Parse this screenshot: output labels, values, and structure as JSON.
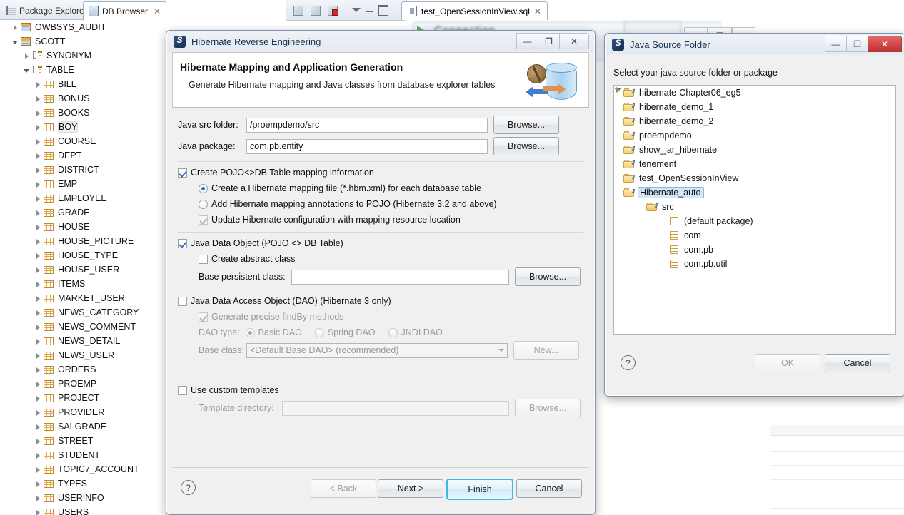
{
  "workbench": {
    "tabs": [
      {
        "label": "Package Explorer",
        "icon": "package-explorer-icon",
        "active": false,
        "closable": false
      },
      {
        "label": "DB Browser",
        "icon": "db-browser-icon",
        "active": true,
        "closable": true
      }
    ],
    "editor_tab": {
      "label": "test_OpenSessionInView.sql",
      "icon": "sql-file-icon",
      "closable": true
    },
    "toolbar_icons": [
      "import-icon",
      "export-icon",
      "refresh-connection-icon",
      "view-menu-icon",
      "minimize-icon",
      "maximize-icon"
    ],
    "ghost_window": {
      "buttons": [
        "minimize",
        "restore",
        "close"
      ]
    }
  },
  "db_tree": [
    {
      "label": "OWBSYS_AUDIT",
      "indent": 1,
      "icon": "schema-icon",
      "state": "collapsed"
    },
    {
      "label": "SCOTT",
      "indent": 1,
      "icon": "schema-icon",
      "state": "expanded"
    },
    {
      "label": "SYNONYM",
      "indent": 2,
      "icon": "group-icon",
      "state": "collapsed"
    },
    {
      "label": "TABLE",
      "indent": 2,
      "icon": "group-icon",
      "state": "expanded"
    },
    {
      "label": "BILL",
      "indent": 3,
      "icon": "table-icon",
      "state": "collapsed"
    },
    {
      "label": "BONUS",
      "indent": 3,
      "icon": "table-icon",
      "state": "collapsed"
    },
    {
      "label": "BOOKS",
      "indent": 3,
      "icon": "table-icon",
      "state": "collapsed"
    },
    {
      "label": "BOY",
      "indent": 3,
      "icon": "table-icon",
      "state": "collapsed",
      "highlight": true
    },
    {
      "label": "COURSE",
      "indent": 3,
      "icon": "table-icon",
      "state": "collapsed"
    },
    {
      "label": "DEPT",
      "indent": 3,
      "icon": "table-icon",
      "state": "collapsed"
    },
    {
      "label": "DISTRICT",
      "indent": 3,
      "icon": "table-icon",
      "state": "collapsed"
    },
    {
      "label": "EMP",
      "indent": 3,
      "icon": "table-icon",
      "state": "collapsed"
    },
    {
      "label": "EMPLOYEE",
      "indent": 3,
      "icon": "table-icon",
      "state": "collapsed"
    },
    {
      "label": "GRADE",
      "indent": 3,
      "icon": "table-icon",
      "state": "collapsed"
    },
    {
      "label": "HOUSE",
      "indent": 3,
      "icon": "table-icon",
      "state": "collapsed"
    },
    {
      "label": "HOUSE_PICTURE",
      "indent": 3,
      "icon": "table-icon",
      "state": "collapsed"
    },
    {
      "label": "HOUSE_TYPE",
      "indent": 3,
      "icon": "table-icon",
      "state": "collapsed"
    },
    {
      "label": "HOUSE_USER",
      "indent": 3,
      "icon": "table-icon",
      "state": "collapsed"
    },
    {
      "label": "ITEMS",
      "indent": 3,
      "icon": "table-icon",
      "state": "collapsed"
    },
    {
      "label": "MARKET_USER",
      "indent": 3,
      "icon": "table-icon",
      "state": "collapsed"
    },
    {
      "label": "NEWS_CATEGORY",
      "indent": 3,
      "icon": "table-icon",
      "state": "collapsed"
    },
    {
      "label": "NEWS_COMMENT",
      "indent": 3,
      "icon": "table-icon",
      "state": "collapsed"
    },
    {
      "label": "NEWS_DETAIL",
      "indent": 3,
      "icon": "table-icon",
      "state": "collapsed"
    },
    {
      "label": "NEWS_USER",
      "indent": 3,
      "icon": "table-icon",
      "state": "collapsed"
    },
    {
      "label": "ORDERS",
      "indent": 3,
      "icon": "table-icon",
      "state": "collapsed"
    },
    {
      "label": "PROEMP",
      "indent": 3,
      "icon": "table-icon",
      "state": "collapsed"
    },
    {
      "label": "PROJECT",
      "indent": 3,
      "icon": "table-icon",
      "state": "collapsed"
    },
    {
      "label": "PROVIDER",
      "indent": 3,
      "icon": "table-icon",
      "state": "collapsed"
    },
    {
      "label": "SALGRADE",
      "indent": 3,
      "icon": "table-icon",
      "state": "collapsed"
    },
    {
      "label": "STREET",
      "indent": 3,
      "icon": "table-icon",
      "state": "collapsed"
    },
    {
      "label": "STUDENT",
      "indent": 3,
      "icon": "table-icon",
      "state": "collapsed"
    },
    {
      "label": "TOPIC7_ACCOUNT",
      "indent": 3,
      "icon": "table-icon",
      "state": "collapsed"
    },
    {
      "label": "TYPES",
      "indent": 3,
      "icon": "table-icon",
      "state": "collapsed"
    },
    {
      "label": "USERINFO",
      "indent": 3,
      "icon": "table-icon",
      "state": "collapsed"
    },
    {
      "label": "USERS",
      "indent": 3,
      "icon": "table-icon",
      "state": "collapsed"
    }
  ],
  "hibernate_dialog": {
    "title": "Hibernate Reverse Engineering",
    "heading": "Hibernate Mapping and Application Generation",
    "subheading": "Generate Hibernate mapping and Java classes from database explorer tables",
    "fields": {
      "src_folder_label": "Java src folder:",
      "src_folder_value": "/proempdemo/src",
      "package_label": "Java package:",
      "package_value": "com.pb.entity",
      "browse_label": "Browse..."
    },
    "pojo_section": {
      "checkbox_label": "Create POJO<>DB Table mapping information",
      "checked": true,
      "radio_hbm": "Create a Hibernate mapping file (*.hbm.xml) for each database table",
      "radio_hbm_selected": true,
      "radio_annotations": "Add Hibernate mapping annotations to POJO (Hibernate 3.2 and above)",
      "radio_annotations_selected": false,
      "update_config_label": "Update Hibernate configuration with mapping resource location",
      "update_config_checked": true
    },
    "jdo_section": {
      "checkbox_label": "Java Data Object (POJO <> DB Table)",
      "checked": true,
      "abstract_label": "Create abstract class",
      "abstract_checked": false,
      "base_class_label": "Base persistent class:",
      "base_class_value": "",
      "browse_label": "Browse..."
    },
    "dao_section": {
      "checkbox_label": "Java Data Access Object (DAO) (Hibernate 3 only)",
      "checked": false,
      "findby_label": "Generate precise findBy methods",
      "findby_checked": true,
      "dao_type_label": "DAO type:",
      "dao_types": [
        {
          "label": "Basic DAO",
          "selected": true
        },
        {
          "label": "Spring DAO",
          "selected": false
        },
        {
          "label": "JNDI DAO",
          "selected": false
        }
      ],
      "base_class_label": "Base class:",
      "base_class_value": "<Default Base DAO> (recommended)",
      "new_label": "New..."
    },
    "templates_section": {
      "checkbox_label": "Use custom templates",
      "checked": false,
      "template_dir_label": "Template directory:",
      "template_dir_value": "",
      "browse_label": "Browse..."
    },
    "buttons": {
      "help": "?",
      "back": "< Back",
      "next": "Next >",
      "finish": "Finish",
      "cancel": "Cancel"
    },
    "window_buttons": {
      "minimize": "—",
      "restore": "❐",
      "close": "✕"
    }
  },
  "java_source_folder_dialog": {
    "title": "Java Source Folder",
    "prompt": "Select your java source folder or package",
    "tree": [
      {
        "label": "hibernate-Chapter06_eg5",
        "indent": 0,
        "icon": "java-folder-icon",
        "state": "collapsed",
        "selected": false
      },
      {
        "label": "hibernate_demo_1",
        "indent": 0,
        "icon": "java-folder-icon",
        "state": "collapsed",
        "selected": false
      },
      {
        "label": "hibernate_demo_2",
        "indent": 0,
        "icon": "java-folder-icon",
        "state": "collapsed",
        "selected": false
      },
      {
        "label": "proempdemo",
        "indent": 0,
        "icon": "java-folder-icon",
        "state": "collapsed",
        "selected": false
      },
      {
        "label": "show_jar_hibernate",
        "indent": 0,
        "icon": "java-folder-icon",
        "state": "collapsed",
        "selected": false
      },
      {
        "label": "tenement",
        "indent": 0,
        "icon": "java-folder-icon",
        "state": "collapsed",
        "selected": false
      },
      {
        "label": "test_OpenSessionInView",
        "indent": 0,
        "icon": "java-folder-icon",
        "state": "collapsed",
        "selected": false
      },
      {
        "label": "Hibernate_auto",
        "indent": 0,
        "icon": "java-folder-icon",
        "state": "expanded",
        "selected": true
      },
      {
        "label": "src",
        "indent": 1,
        "icon": "source-folder-icon",
        "state": "expanded",
        "selected": false
      },
      {
        "label": "(default package)",
        "indent": 2,
        "icon": "package-icon",
        "state": "leaf",
        "selected": false
      },
      {
        "label": "com",
        "indent": 2,
        "icon": "package-icon",
        "state": "leaf",
        "selected": false
      },
      {
        "label": "com.pb",
        "indent": 2,
        "icon": "package-icon",
        "state": "leaf",
        "selected": false
      },
      {
        "label": "com.pb.util",
        "indent": 2,
        "icon": "package-icon",
        "state": "collapsed",
        "selected": false
      }
    ],
    "buttons": {
      "help": "?",
      "ok": "OK",
      "ok_enabled": false,
      "cancel": "Cancel"
    },
    "window_buttons": {
      "minimize": "—",
      "restore": "❐",
      "close": "✕"
    }
  },
  "colors": {
    "accent_default_button": "#3fb8e8",
    "selection_blue": "#d3e6f7",
    "close_red": "#c02d2d",
    "table_icon_orange": "#e2a94c"
  }
}
